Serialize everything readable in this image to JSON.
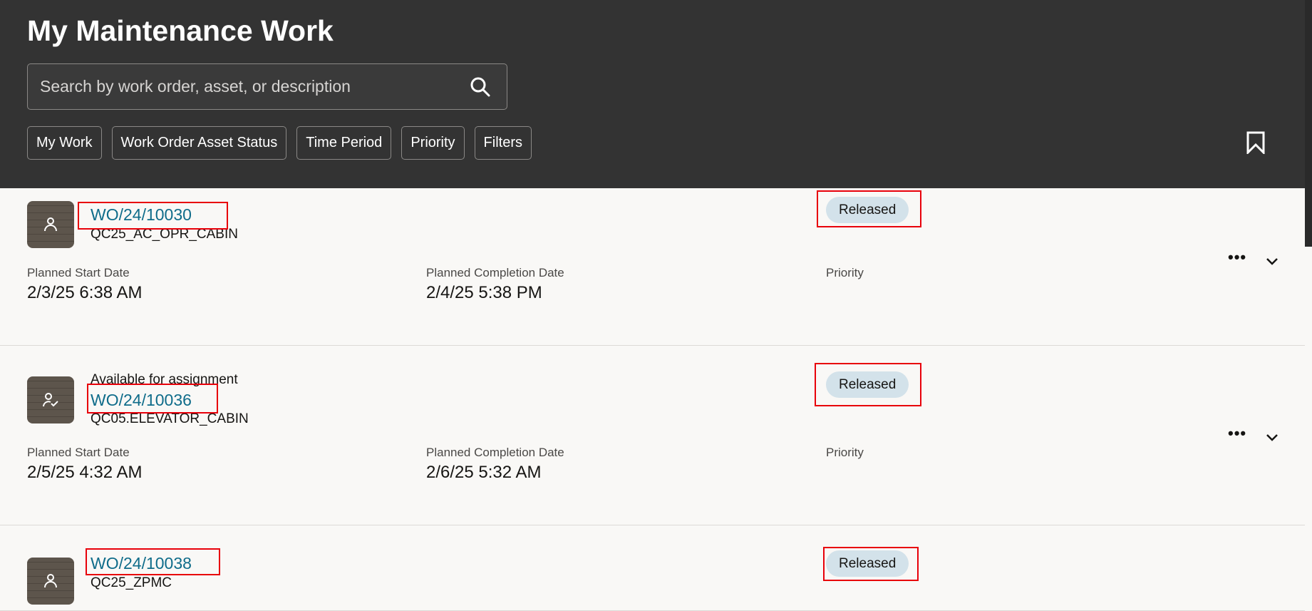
{
  "header": {
    "title": "My Maintenance Work",
    "search_placeholder": "Search by work order, asset, or description",
    "chips": [
      "My Work",
      "Work Order Asset Status",
      "Time Period",
      "Priority",
      "Filters"
    ]
  },
  "labels": {
    "start": "Planned Start Date",
    "completion": "Planned Completion Date",
    "priority": "Priority"
  },
  "work_orders": [
    {
      "number": "WO/24/10030",
      "asset": "QC25_AC_OPR_CABIN",
      "status": "Released",
      "start": "2/3/25 6:38 AM",
      "completion": "2/4/25 5:38 PM",
      "note": ""
    },
    {
      "number": "WO/24/10036",
      "asset": "QC05.ELEVATOR_CABIN",
      "status": "Released",
      "start": "2/5/25 4:32 AM",
      "completion": "2/6/25 5:32 AM",
      "note": "Available for assignment"
    },
    {
      "number": "WO/24/10038",
      "asset": "QC25_ZPMC",
      "status": "Released"
    }
  ],
  "colors": {
    "header": "#333333",
    "link": "#0f6c8a",
    "pill": "#d3e2ea",
    "annotation": "#e8000a"
  }
}
